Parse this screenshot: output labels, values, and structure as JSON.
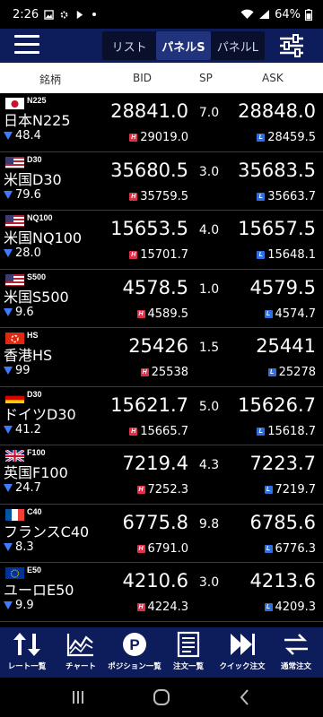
{
  "status_bar": {
    "time": "2:26",
    "battery": "64%"
  },
  "header": {
    "tabs": [
      {
        "label": "リスト",
        "active": false
      },
      {
        "label": "パネルS",
        "active": true
      },
      {
        "label": "パネルL",
        "active": false
      }
    ]
  },
  "columns": {
    "name": "銘柄",
    "bid": "BID",
    "sp": "SP",
    "ask": "ASK"
  },
  "instruments": [
    {
      "code": "N225",
      "name": "日本N225",
      "flag": "jp",
      "change": "48.4",
      "bid": "28841.0",
      "sp": "7.0",
      "ask": "28848.0",
      "high": "29019.0",
      "low": "28459.5"
    },
    {
      "code": "D30",
      "name": "米国D30",
      "flag": "us",
      "change": "79.6",
      "bid": "35680.5",
      "sp": "3.0",
      "ask": "35683.5",
      "high": "35759.5",
      "low": "35663.7"
    },
    {
      "code": "NQ100",
      "name": "米国NQ100",
      "flag": "us",
      "change": "28.0",
      "bid": "15653.5",
      "sp": "4.0",
      "ask": "15657.5",
      "high": "15701.7",
      "low": "15648.1"
    },
    {
      "code": "S500",
      "name": "米国S500",
      "flag": "us",
      "change": "9.6",
      "bid": "4578.5",
      "sp": "1.0",
      "ask": "4579.5",
      "high": "4589.5",
      "low": "4574.7"
    },
    {
      "code": "HS",
      "name": "香港HS",
      "flag": "hk",
      "change": "99",
      "bid": "25426",
      "sp": "1.5",
      "ask": "25441",
      "high": "25538",
      "low": "25278"
    },
    {
      "code": "D30",
      "name": "ドイツD30",
      "flag": "de",
      "change": "41.2",
      "bid": "15621.7",
      "sp": "5.0",
      "ask": "15626.7",
      "high": "15665.7",
      "low": "15618.7"
    },
    {
      "code": "F100",
      "name": "英国F100",
      "flag": "uk",
      "change": "24.7",
      "bid": "7219.4",
      "sp": "4.3",
      "ask": "7223.7",
      "high": "7252.3",
      "low": "7219.7"
    },
    {
      "code": "C40",
      "name": "フランスC40",
      "flag": "fr",
      "change": "8.3",
      "bid": "6775.8",
      "sp": "9.8",
      "ask": "6785.6",
      "high": "6791.0",
      "low": "6776.3"
    },
    {
      "code": "E50",
      "name": "ユーロE50",
      "flag": "eu",
      "change": "9.9",
      "bid": "4210.6",
      "sp": "3.0",
      "ask": "4213.6",
      "high": "4224.3",
      "low": "4209.3"
    }
  ],
  "bottom_nav": [
    {
      "label": "レート一覧",
      "icon": "sort-arrows-icon"
    },
    {
      "label": "チャート",
      "icon": "chart-icon"
    },
    {
      "label": "ポジション一覧",
      "icon": "position-icon"
    },
    {
      "label": "注文一覧",
      "icon": "order-list-icon"
    },
    {
      "label": "クイック注文",
      "icon": "quick-order-icon"
    },
    {
      "label": "通常注文",
      "icon": "normal-order-icon"
    }
  ],
  "colors": {
    "header_bg": "#0d1c5a",
    "down_arrow": "#3d7bff",
    "high_badge": "#e0304a",
    "low_badge": "#2f6fe0"
  }
}
